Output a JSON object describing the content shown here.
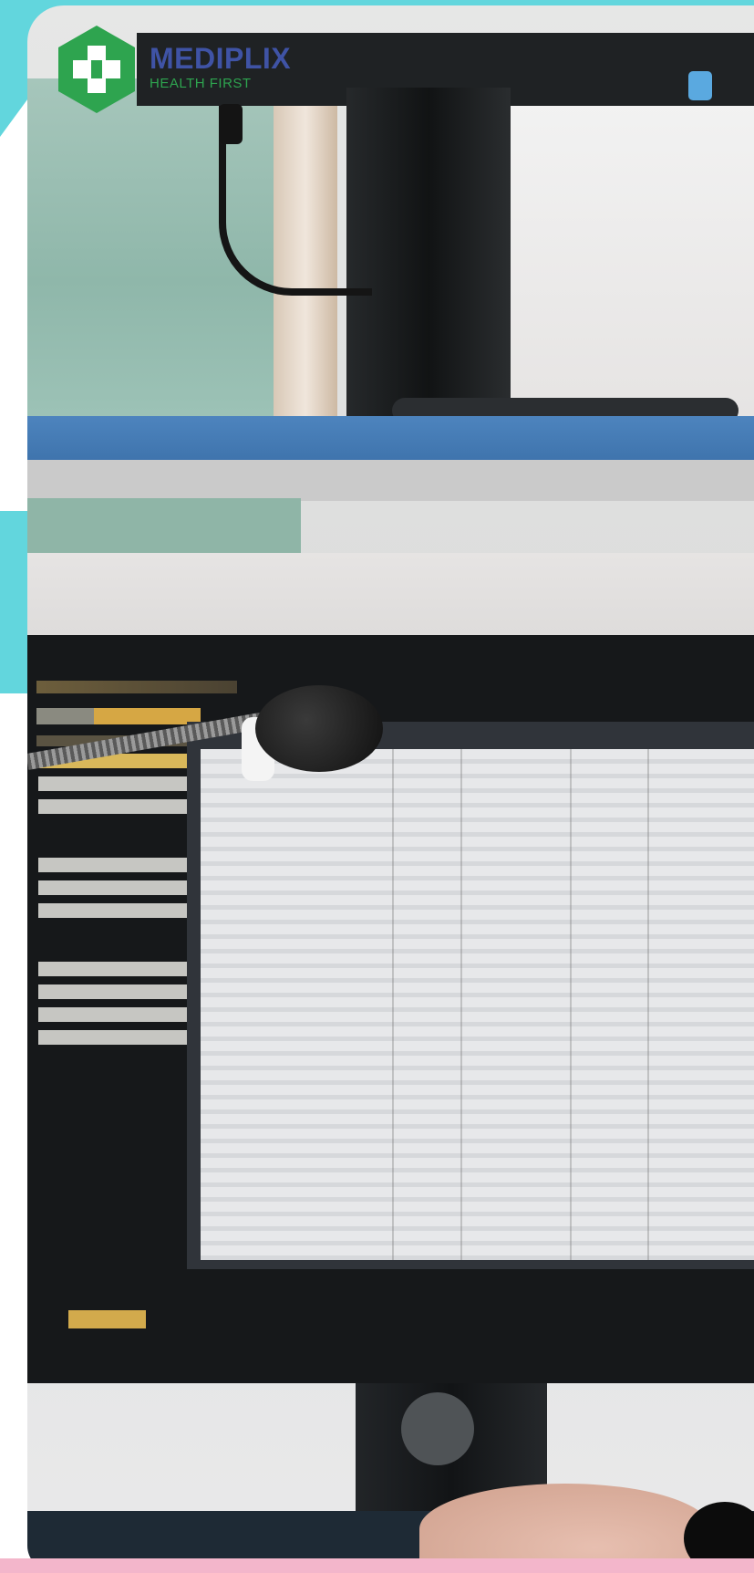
{
  "brand": {
    "name": "MEDIPLIX",
    "tagline": "HEALTH FIRST",
    "logo_icon": "medical-cross-hexagon-icon",
    "colors": {
      "name": "#3f53a5",
      "tagline": "#2ea44f",
      "logo_bg": "#2ea44f",
      "accent_cyan": "#62d6dd",
      "accent_pink": "#f3b6cb"
    }
  }
}
